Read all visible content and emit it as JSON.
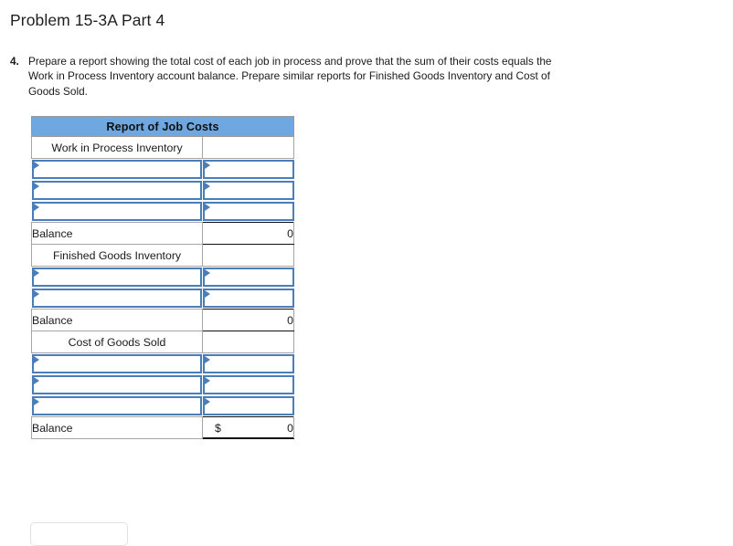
{
  "page": {
    "title": "Problem 15-3A Part 4"
  },
  "instruction": {
    "number": "4.",
    "text": "Prepare a report showing the total cost of each job in process and prove that the sum of their costs equals the Work in Process Inventory account balance. Prepare similar reports for Finished Goods Inventory and Cost of Goods Sold."
  },
  "report": {
    "header": "Report of Job Costs",
    "balance_label": "Balance",
    "currency_symbol": "$",
    "sections": [
      {
        "title": "Work in Process Inventory",
        "input_rows": 3,
        "balance_value": "0",
        "show_currency": false
      },
      {
        "title": "Finished Goods Inventory",
        "input_rows": 2,
        "balance_value": "0",
        "show_currency": false
      },
      {
        "title": "Cost of Goods Sold",
        "input_rows": 3,
        "balance_value": "0",
        "show_currency": true
      }
    ]
  },
  "colors": {
    "header_blue": "#6fa8e0",
    "input_border_blue": "#4a7ebb",
    "grid_gray": "#a6a6a6",
    "rule_black": "#111111"
  }
}
